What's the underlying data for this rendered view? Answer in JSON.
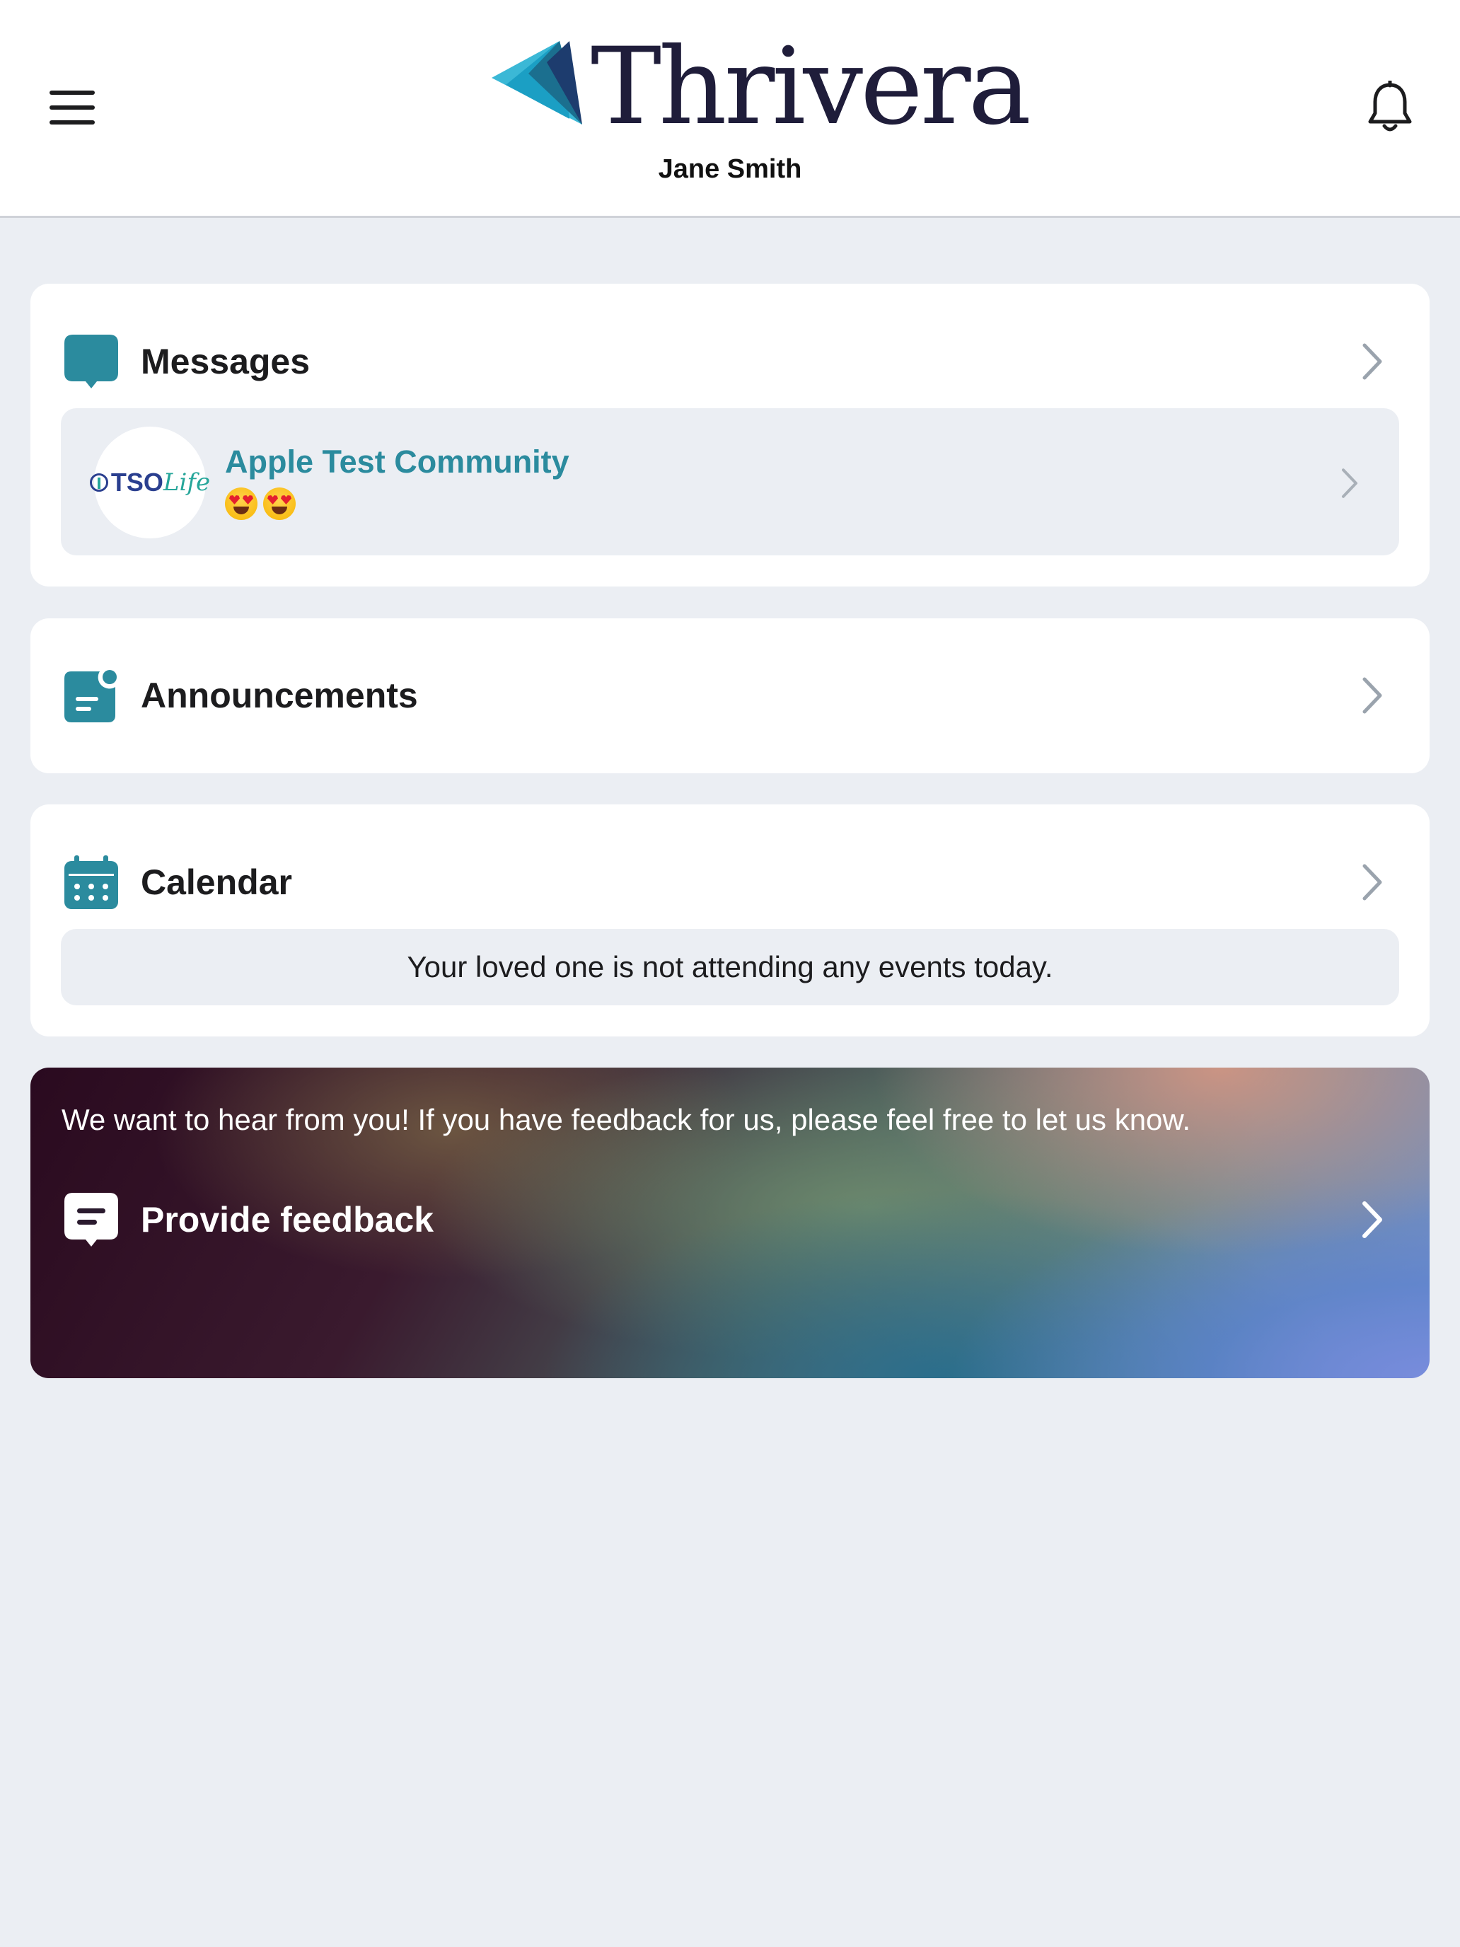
{
  "header": {
    "brand_name": "Thrivera",
    "user_name": "Jane Smith"
  },
  "messages": {
    "title": "Messages",
    "items": [
      {
        "community_name": "Apple Test Community",
        "avatar_text_main": "TSO",
        "avatar_text_accent": "Life",
        "preview": "😍 😍"
      }
    ]
  },
  "announcements": {
    "title": "Announcements"
  },
  "calendar": {
    "title": "Calendar",
    "empty_text": "Your loved one is not attending any events today."
  },
  "feedback": {
    "prompt": "We want to hear from you! If you have feedback for us, please feel free to let us know.",
    "action_label": "Provide feedback"
  },
  "colors": {
    "accent_teal": "#2b8b9e",
    "brand_navy": "#1f1d3a",
    "page_background": "#ebeef3",
    "chevron_gray": "#9aa3ad"
  },
  "icons": {
    "menu": "hamburger-menu-icon",
    "notifications": "bell-icon",
    "messages": "chat-bubble-icon",
    "announcements": "announcement-icon",
    "calendar": "calendar-icon",
    "feedback": "feedback-bubble-icon",
    "navigate": "chevron-right-icon"
  }
}
